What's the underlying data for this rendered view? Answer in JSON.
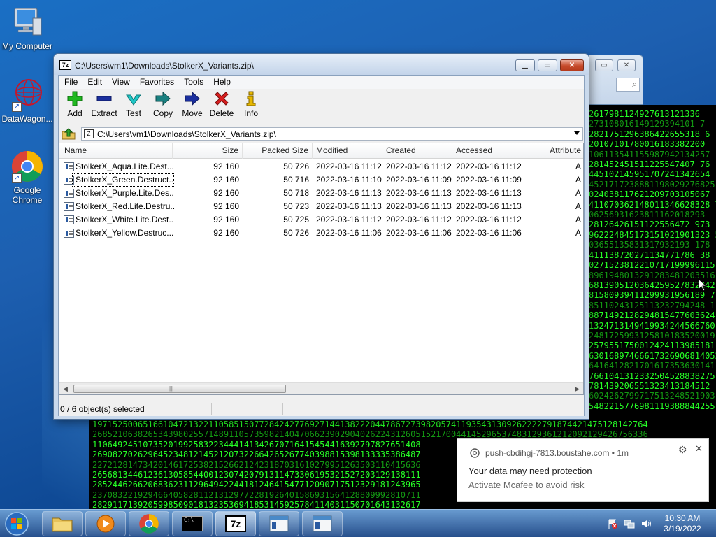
{
  "desktop": {
    "icons": [
      {
        "label": "My Computer"
      },
      {
        "label": "DataWagon..."
      },
      {
        "label": "Google Chrome"
      }
    ]
  },
  "matrix_lines": [
    "2617981124927613121336",
    "273108016149129394101 7",
    "2821751296386422655318 6",
    "20107101780016183382200",
    "106113541155987942134257",
    "281452451511225547407 76",
    "445102145951707241342654",
    "4521717238881198029276825",
    "024038117621209703105067",
    "411070362148011346628328 7",
    "06256931623811162018293",
    "28126426151122556472 973",
    "962224845173151021901323 5",
    "03655135831317932193 178",
    "411138720271134771786 38",
    "0271523812210717199996115",
    "8961948013291283481203516",
    "6813905120364259527832242",
    "81580939411299931956189 7",
    "85110243125113232794248 1",
    "8871492128294815477603624",
    "1324713149419934244566760",
    "2481725993125810183520019",
    "2579551750012424113985181",
    "63016897466617326906814052",
    "6416412821701617353630141",
    "7661041312332504528838275",
    "781439206551323413184512",
    "6024262799717513248521903",
    "5482215776981119388844255"
  ],
  "matrix_bottom": [
    "19715250065166104721322110585150772842427769271441382220447867273982057411935431309262222791874421475128142764",
    "26852106382653439802557148911057359821404706623902904026224312605152170044145296537483129361212092129426756336",
    "11064924510735201992583223444141342670716415454416392797827651408",
    "26908270262964523481214521207322664265267740398815398133335386487",
    "22721281473420146172538215266212423187031610279951263503110415636",
    "26568134461236130585440012307420791311473306195321527203129138111",
    "28524462662068362311296494224418124641547712090717512329181243965",
    "23708322192946640582811213129772281926401586931564128809992810711",
    "28291171392059985090181323536941853145925784114031150701643132617",
    "17404133001634180561752218594404321954116852191212074152402012056",
    "10502583352149261612613232114262325281911261327040501381"
  ],
  "bg_window": {
    "restore_symbol": "▭",
    "close_symbol": "✕"
  },
  "window": {
    "title": "C:\\Users\\vm1\\Downloads\\StolkerX_Variants.zip\\",
    "minimize_symbol": "▁",
    "maximize_symbol": "▭",
    "close_symbol": "✕",
    "app_icon_text": "7z"
  },
  "menu": [
    "File",
    "Edit",
    "View",
    "Favorites",
    "Tools",
    "Help"
  ],
  "toolbar": [
    {
      "label": "Add",
      "icon": "plus-icon",
      "color": "#1fb81f"
    },
    {
      "label": "Extract",
      "icon": "minus-icon",
      "color": "#1b2f9e"
    },
    {
      "label": "Test",
      "icon": "check-icon",
      "color": "#20b4b4"
    },
    {
      "label": "Copy",
      "icon": "copy-arrow-icon",
      "color": "#1a8080"
    },
    {
      "label": "Move",
      "icon": "move-arrow-icon",
      "color": "#1b2f9e"
    },
    {
      "label": "Delete",
      "icon": "x-icon",
      "color": "#d81e1e"
    },
    {
      "label": "Info",
      "icon": "info-icon",
      "color": "#d8a800"
    }
  ],
  "address": {
    "path": "C:\\Users\\vm1\\Downloads\\StolkerX_Variants.zip\\"
  },
  "columns": [
    "Name",
    "Size",
    "Packed Size",
    "Modified",
    "Created",
    "Accessed",
    "Attribute"
  ],
  "files": [
    {
      "name": "StolkerX_Aqua.Lite.Dest...",
      "size": "92 160",
      "packed": "50 726",
      "modified": "2022-03-16 11:12",
      "created": "2022-03-16 11:12",
      "accessed": "2022-03-16 11:12",
      "attr": "A"
    },
    {
      "name": "StolkerX_Green.Destruct...",
      "size": "92 160",
      "packed": "50 716",
      "modified": "2022-03-16 11:10",
      "created": "2022-03-16 11:09",
      "accessed": "2022-03-16 11:09",
      "attr": "A"
    },
    {
      "name": "StolkerX_Purple.Lite.Des...",
      "size": "92 160",
      "packed": "50 718",
      "modified": "2022-03-16 11:13",
      "created": "2022-03-16 11:13",
      "accessed": "2022-03-16 11:13",
      "attr": "A"
    },
    {
      "name": "StolkerX_Red.Lite.Destru...",
      "size": "92 160",
      "packed": "50 723",
      "modified": "2022-03-16 11:13",
      "created": "2022-03-16 11:13",
      "accessed": "2022-03-16 11:13",
      "attr": "A"
    },
    {
      "name": "StolkerX_White.Lite.Dest...",
      "size": "92 160",
      "packed": "50 725",
      "modified": "2022-03-16 11:12",
      "created": "2022-03-16 11:12",
      "accessed": "2022-03-16 11:12",
      "attr": "A"
    },
    {
      "name": "StolkerX_Yellow.Destruc...",
      "size": "92 160",
      "packed": "50 726",
      "modified": "2022-03-16 11:06",
      "created": "2022-03-16 11:06",
      "accessed": "2022-03-16 11:06",
      "attr": "A"
    }
  ],
  "status": {
    "selected": "0 / 6 object(s) selected"
  },
  "notification": {
    "source": "push-cbdihgj-7813.boustahe.com",
    "time": "1m",
    "line1": "Your data may need protection",
    "line2": "Activate Mcafee to avoid risk",
    "gear_symbol": "⚙",
    "close_symbol": "✕"
  },
  "taskbar": {
    "cmd_icon_text": "C:\\",
    "zip_icon_text": "7z",
    "time": "10:30 AM",
    "date": "3/19/2022"
  }
}
